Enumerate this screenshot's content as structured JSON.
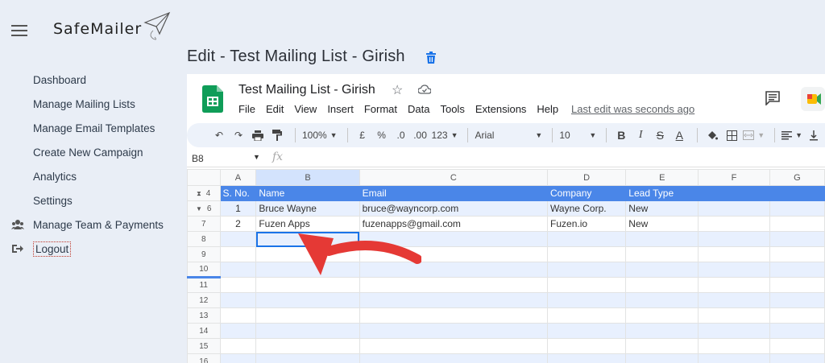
{
  "brand": {
    "name": "SafeMailer"
  },
  "sidebar": {
    "items": [
      {
        "label": "Dashboard"
      },
      {
        "label": "Manage Mailing Lists"
      },
      {
        "label": "Manage Email Templates"
      },
      {
        "label": "Create New Campaign"
      },
      {
        "label": "Analytics"
      },
      {
        "label": "Settings"
      },
      {
        "label": "Manage Team & Payments",
        "icon": "team-icon"
      },
      {
        "label": "Logout",
        "icon": "logout-icon"
      }
    ]
  },
  "page": {
    "title": "Edit - Test Mailing List - Girish",
    "title_icon": "trash-icon"
  },
  "sheet": {
    "doc_title": "Test Mailing List - Girish",
    "menu": [
      "File",
      "Edit",
      "View",
      "Insert",
      "Format",
      "Data",
      "Tools",
      "Extensions",
      "Help"
    ],
    "last_edit": "Last edit was seconds ago",
    "toolbar": {
      "zoom": "100%",
      "currency": "£",
      "percent": "%",
      "dec_less": ".0",
      "dec_more": ".00",
      "number_format": "123",
      "font": "Arial",
      "font_size": "10",
      "bold": "B",
      "italic": "I",
      "strike": "S",
      "text_color": "A"
    },
    "name_box": "B8",
    "fx": "fx",
    "columns": [
      "A",
      "B",
      "C",
      "D",
      "E",
      "F",
      "G"
    ],
    "header_row": {
      "row": "4",
      "cells": [
        "S. No.",
        "Name",
        "Email",
        "Company",
        "Lead Type"
      ]
    },
    "rows": [
      {
        "row": "6",
        "cells": [
          "1",
          "Bruce Wayne",
          "bruce@wayncorp.com",
          "Wayne Corp.",
          "New"
        ]
      },
      {
        "row": "7",
        "cells": [
          "2",
          "Fuzen Apps",
          "fuzenapps@gmail.com",
          "Fuzen.io",
          "New"
        ]
      }
    ],
    "empty_rows": [
      "8",
      "9",
      "10",
      "11",
      "12",
      "13",
      "14",
      "15",
      "16"
    ],
    "colors": {
      "header_fill": "#4a86e8",
      "band_fill": "#e8f0fe",
      "selection": "#1a73e8",
      "annotation_arrow": "#e53935"
    }
  }
}
